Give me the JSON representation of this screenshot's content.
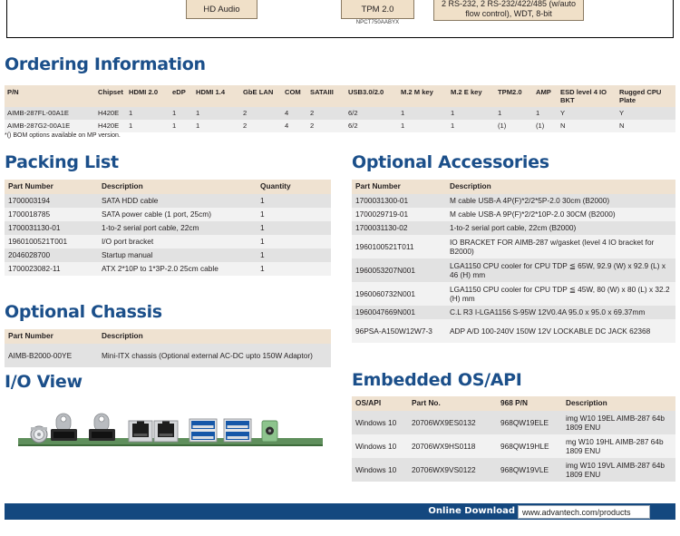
{
  "diagram": {
    "blocks": [
      {
        "id": "hd-audio",
        "label": "HD Audio"
      },
      {
        "id": "tpm",
        "label": "TPM 2.0",
        "sublabel": "NPCT750AABYX"
      },
      {
        "id": "serial",
        "label": "2 RS-232, 2 RS-232/422/485 (w/auto flow control), WDT, 8-bit"
      }
    ]
  },
  "sections": {
    "ordering": "Ordering Information",
    "packing": "Packing List",
    "accessories": "Optional Accessories",
    "chassis": "Optional Chassis",
    "io_view": "I/O View",
    "embedded_os": "Embedded OS/API"
  },
  "ordering": {
    "columns": [
      "P/N",
      "Chipset",
      "HDMI 2.0",
      "eDP",
      "HDMI 1.4",
      "GbE LAN",
      "COM",
      "SATAIII",
      "USB3.0/2.0",
      "M.2 M key",
      "M.2 E key",
      "TPM2.0",
      "AMP",
      "ESD level 4 IO BKT",
      "Rugged CPU Plate"
    ],
    "rows": [
      [
        "AIMB-287FL-00A1E",
        "H420E",
        "1",
        "1",
        "1",
        "2",
        "4",
        "2",
        "6/2",
        "1",
        "1",
        "1",
        "1",
        "Y",
        "Y"
      ],
      [
        "AIMB-287G2-00A1E",
        "H420E",
        "1",
        "1",
        "1",
        "2",
        "4",
        "2",
        "6/2",
        "1",
        "1",
        "(1)",
        "(1)",
        "N",
        "N"
      ]
    ],
    "footnote": "*() BOM options available on MP version."
  },
  "packing": {
    "columns": [
      "Part Number",
      "Description",
      "Quantity"
    ],
    "rows": [
      [
        "1700003194",
        "SATA HDD cable",
        "1"
      ],
      [
        "1700018785",
        "SATA power cable (1 port, 25cm)",
        "1"
      ],
      [
        "1700031130-01",
        "1-to-2 serial port cable, 22cm",
        "1"
      ],
      [
        "1960100521T001",
        "I/O port bracket",
        "1"
      ],
      [
        "2046028700",
        "Startup manual",
        "1"
      ],
      [
        "1700023082-11",
        "ATX 2*10P to 1*3P-2.0 25cm cable",
        "1"
      ]
    ]
  },
  "accessories": {
    "columns": [
      "Part Number",
      "Description"
    ],
    "rows": [
      [
        "1700031300-01",
        "M cable USB-A 4P(F)*2/2*5P-2.0 30cm (B2000)"
      ],
      [
        "1700029719-01",
        "M cable USB-A 9P(F)*2/2*10P-2.0 30CM (B2000)"
      ],
      [
        "1700031130-02",
        "1-to-2 serial port cable, 22cm (B2000)"
      ],
      [
        "1960100521T011",
        "IO BRACKET FOR AIMB-287 w/gasket (level 4 IO bracket for B2000)"
      ],
      [
        "1960053207N001",
        "LGA1150 CPU cooler for CPU TDP ≦ 65W, 92.9 (W) x 92.9 (L) x 46 (H) mm"
      ],
      [
        "1960060732N001",
        "LGA1150 CPU cooler for CPU TDP ≦ 45W, 80 (W) x 80 (L) x 32.2 (H) mm"
      ],
      [
        "1960047669N001",
        "C.L R3 I-LGA1156 S-95W 12V0.4A 95.0 x 95.0 x 69.37mm"
      ],
      [
        "96PSA-A150W12W7-3",
        "ADP A/D 100-240V 150W 12V LOCKABLE DC JACK 62368"
      ]
    ]
  },
  "chassis": {
    "columns": [
      "Part Number",
      "Description"
    ],
    "rows": [
      [
        "AIMB-B2000-00YE",
        "Mini-ITX chassis (Optional external AC-DC upto 150W Adaptor)"
      ]
    ]
  },
  "embedded_os": {
    "columns": [
      "OS/API",
      "Part No.",
      "968 P/N",
      "Description"
    ],
    "rows": [
      [
        "Windows 10",
        "20706WX9ES0132",
        "968QW19ELE",
        "img W10 19EL AIMB-287 64b 1809 ENU"
      ],
      [
        "Windows 10",
        "20706WX9HS0118",
        "968QW19HLE",
        "mg W10 19HL AIMB-287 64b 1809 ENU"
      ],
      [
        "Windows 10",
        "20706WX9VS0122",
        "968QW19VLE",
        "img W10 19VL AIMB-287 64b 1809 ENU"
      ]
    ]
  },
  "footer": {
    "label": "Online Download",
    "url": "www.advantech.com/products"
  },
  "colors": {
    "heading_blue": "#1b4f8a",
    "footer_blue": "#14487f",
    "table_header_tan": "#efe2d1",
    "row_dark": "#e2e2e2",
    "row_light": "#f2f2f2",
    "block_fill": "#f0e0c8"
  }
}
